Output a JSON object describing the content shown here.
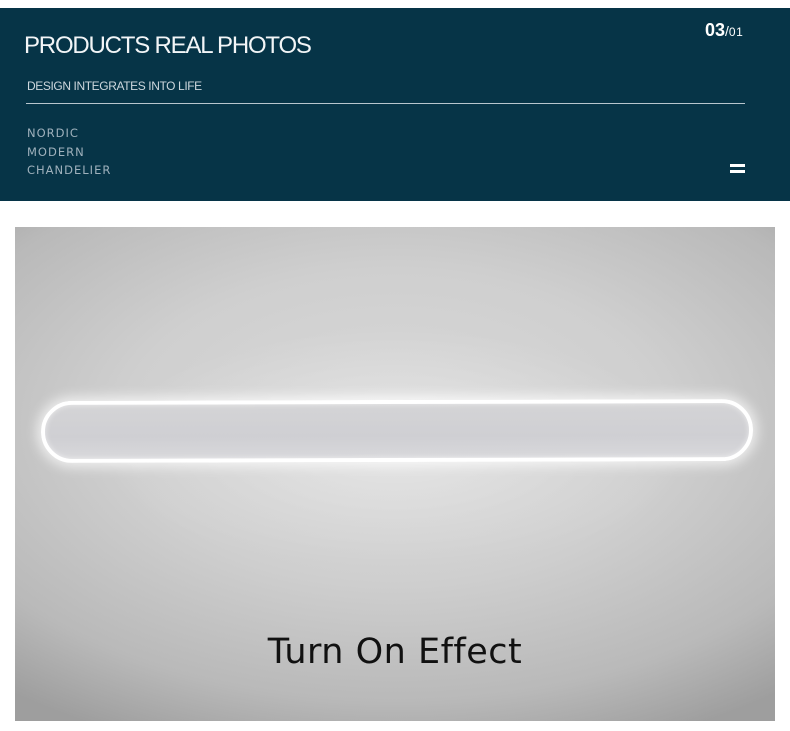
{
  "banner": {
    "title": "PRODUCTS REAL PHOTOS",
    "subtitle": "DESIGN INTEGRATES INTO LIFE",
    "page_current": "03",
    "page_separator": "/",
    "page_total": "01",
    "tagline": [
      "NORDIC",
      "MODERN",
      "CHANDELIER"
    ],
    "menu_icon": "menu-icon",
    "background_color": "#063447"
  },
  "photo": {
    "caption": "Turn On Effect"
  }
}
